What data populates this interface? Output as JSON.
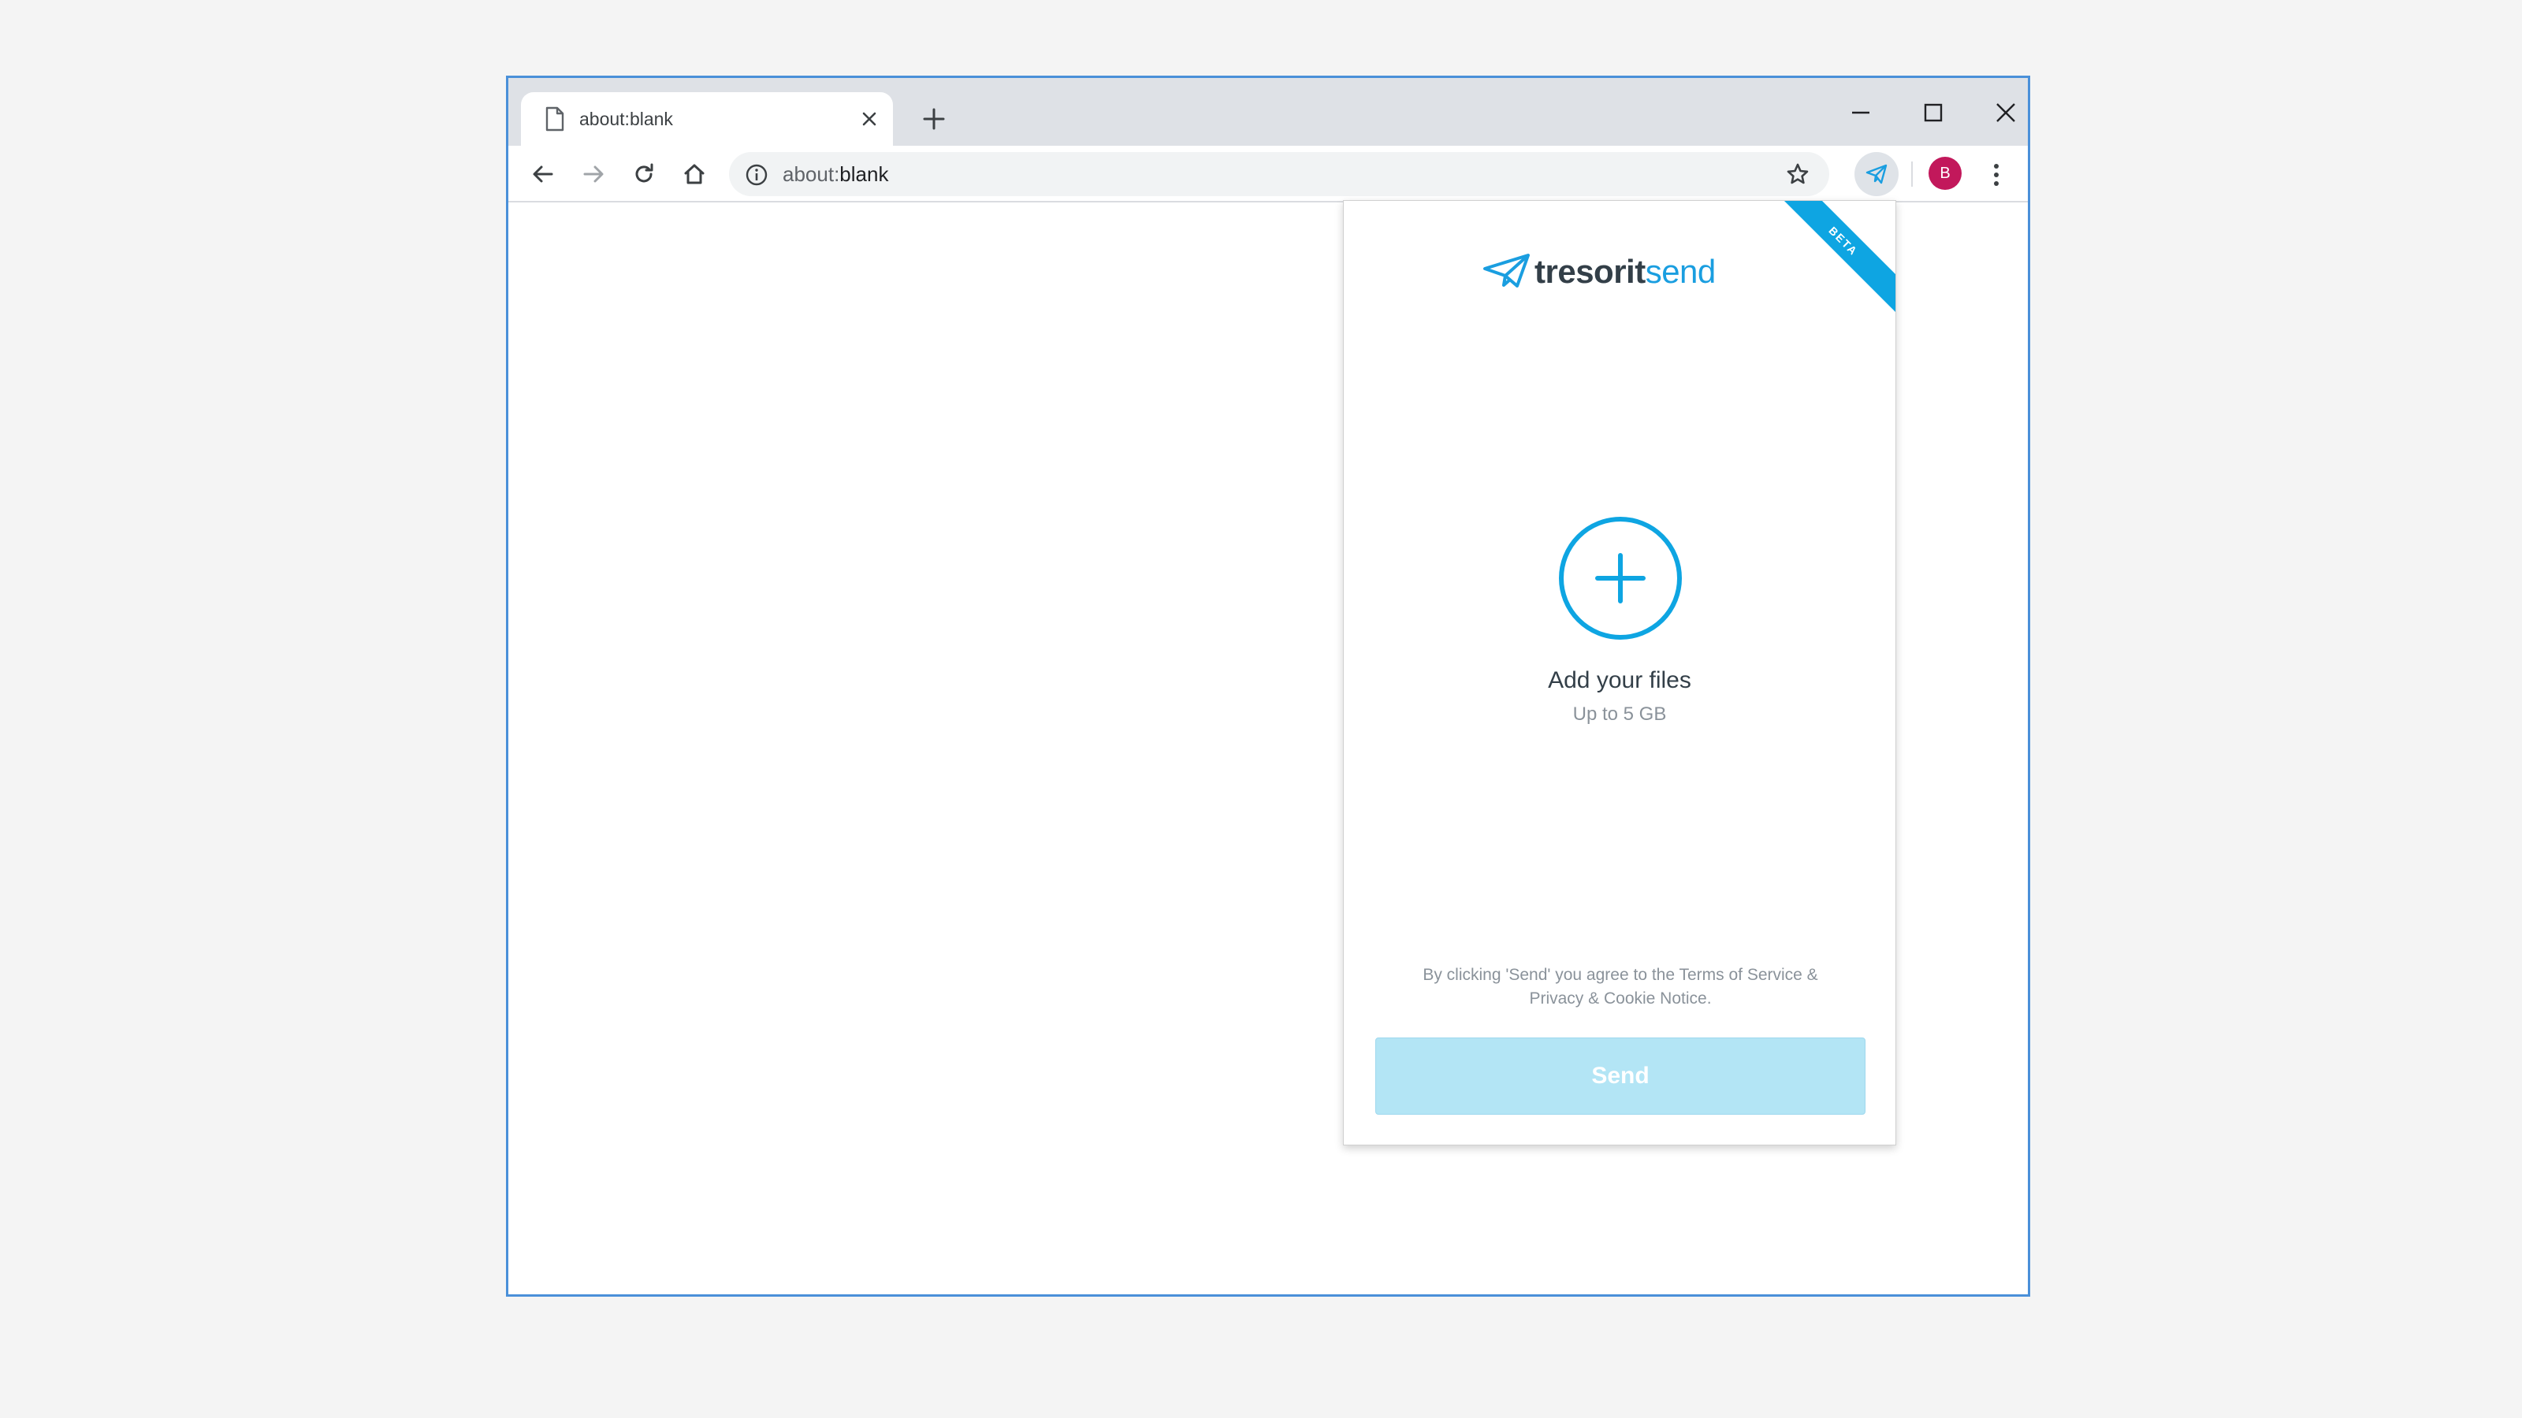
{
  "browser": {
    "tab": {
      "title": "about:blank",
      "page_icon": "page-icon",
      "close_icon": "close-icon"
    },
    "new_tab_icon": "plus-icon",
    "window_controls": [
      "minimize-icon",
      "maximize-icon",
      "close-icon"
    ],
    "toolbar": {
      "back_icon": "arrow-left-icon",
      "forward_icon": "arrow-right-icon",
      "reload_icon": "reload-icon",
      "home_icon": "home-icon",
      "omnibox": {
        "scheme": "about:",
        "rest": "blank",
        "info_icon": "info-icon",
        "bookmark_icon": "star-icon"
      },
      "extension_icon": "paper-plane-icon",
      "profile_initial": "B",
      "profile_color": "#c2185b",
      "menu_icon": "more-vert-icon"
    }
  },
  "popup": {
    "ribbon": "BETA",
    "brand_part1": "tresorit",
    "brand_part2": "send",
    "accent_color": "#0ea5e2",
    "add_title": "Add your files",
    "add_subtitle": "Up to 5 GB",
    "legal_line1": "By clicking 'Send' you agree to the Terms of Service &",
    "legal_line2": "Privacy & Cookie Notice.",
    "send_label": "Send"
  }
}
